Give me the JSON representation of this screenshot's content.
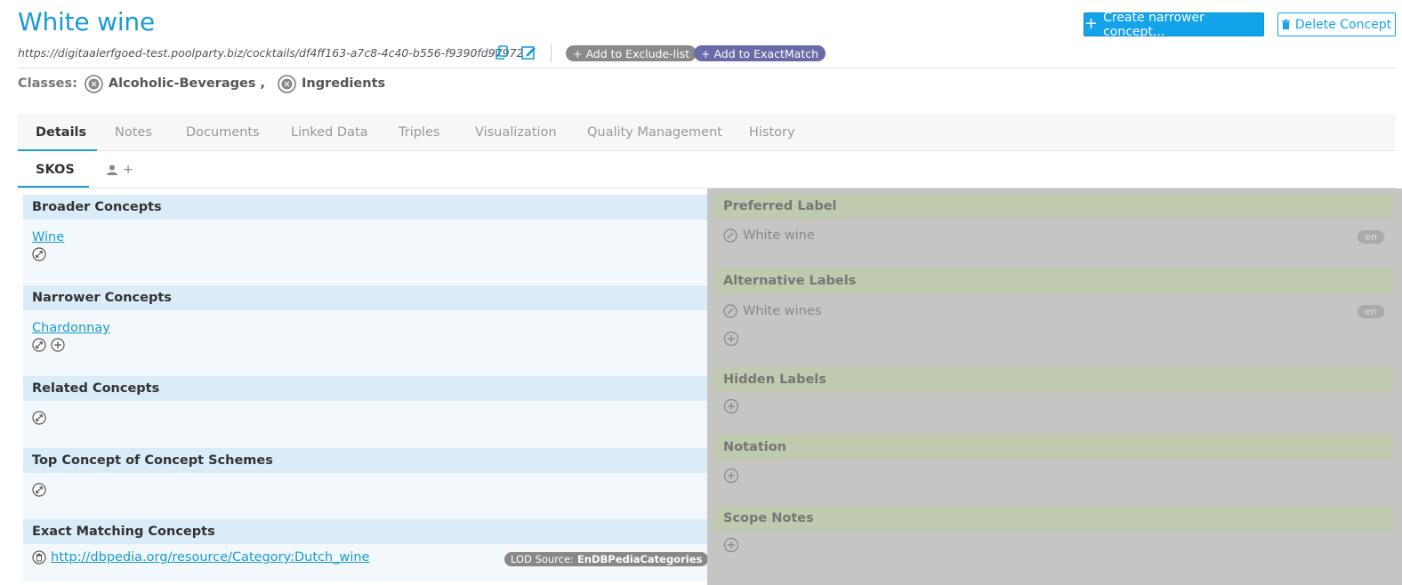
{
  "page": {
    "title": "White wine",
    "uri": "https://digitaalerfgoed-test.poolparty.biz/cocktails/df4ff163-a7c8-4c40-b556-f9390fd97972"
  },
  "actions": {
    "create_narrower": "Create narrower concept...",
    "delete_concept": "Delete Concept",
    "add_exclude": "+ Add to Exclude-list",
    "add_exactmatch": "+ Add to ExactMatch"
  },
  "classes": {
    "label": "Classes:",
    "items": [
      "Alcoholic-Beverages",
      "Ingredients"
    ],
    "separator": ","
  },
  "tabs": [
    "Details",
    "Notes",
    "Documents",
    "Linked Data",
    "Triples",
    "Visualization",
    "Quality Management",
    "History"
  ],
  "subtabs": {
    "active": "SKOS",
    "add": "+"
  },
  "left": {
    "broader": {
      "title": "Broader Concepts",
      "items": [
        "Wine"
      ]
    },
    "narrower": {
      "title": "Narrower Concepts",
      "items": [
        "Chardonnay"
      ]
    },
    "related": {
      "title": "Related Concepts"
    },
    "top_concept": {
      "title": "Top Concept of Concept Schemes"
    },
    "exact": {
      "title": "Exact Matching Concepts",
      "items": [
        "http://dbpedia.org/resource/Category:Dutch_wine"
      ],
      "lod_label": "LOD Source:",
      "lod_value": "EnDBPediaCategories"
    }
  },
  "right": {
    "preferred": {
      "title": "Preferred Label",
      "value": "White wine",
      "lang": "en"
    },
    "alternative": {
      "title": "Alternative Labels",
      "value": "White wines",
      "lang": "en"
    },
    "hidden": {
      "title": "Hidden Labels"
    },
    "notation": {
      "title": "Notation"
    },
    "scope": {
      "title": "Scope Notes"
    }
  },
  "colors": {
    "accent": "#1a9bd7",
    "overlay": "#c5c5c3",
    "section_head": "#d9ecf7"
  }
}
